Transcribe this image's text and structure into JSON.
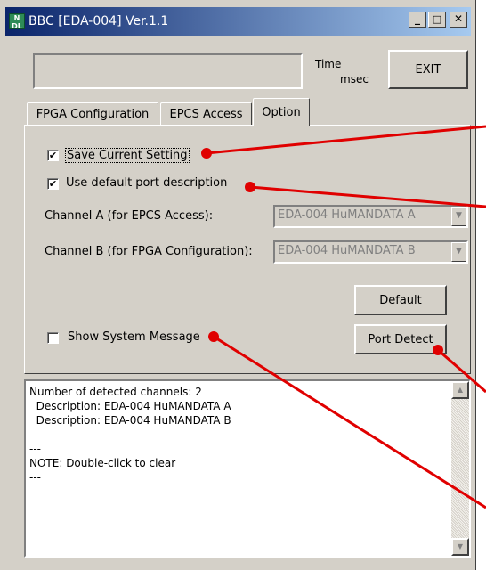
{
  "window": {
    "icon_text": "N\nDL",
    "title": "BBC [EDA-004] Ver.1.1",
    "minimize_label": "_",
    "maximize_label": "□",
    "close_label": "✕"
  },
  "header": {
    "time_label": "Time",
    "unit_label": "msec",
    "status_value": "",
    "exit_label": "EXIT"
  },
  "tabs": [
    {
      "label": "FPGA Configuration",
      "active": false
    },
    {
      "label": "EPCS Access",
      "active": false
    },
    {
      "label": "Option",
      "active": true
    }
  ],
  "option": {
    "save_setting": {
      "label": "Save Current Setting",
      "checked": true
    },
    "default_port": {
      "label": "Use default port description",
      "checked": true
    },
    "channel_a": {
      "label": "Channel A (for EPCS Access):",
      "value": "EDA-004 HuMANDATA A"
    },
    "channel_b": {
      "label": "Channel B (for FPGA Configuration):",
      "value": "EDA-004 HuMANDATA B"
    },
    "default_button": "Default",
    "port_detect_button": "Port Detect",
    "show_system_message": {
      "label": "Show System Message",
      "checked": false
    },
    "check_glyph": "✔",
    "dropdown_glyph": "▼"
  },
  "log": {
    "lines": "Number of detected channels: 2\n  Description: EDA-004 HuMANDATA A\n  Description: EDA-004 HuMANDATA B\n\n---\nNOTE: Double-click to clear\n---",
    "scroll_up_glyph": "▲",
    "scroll_down_glyph": "▼"
  },
  "annotation_color": "#e00000"
}
